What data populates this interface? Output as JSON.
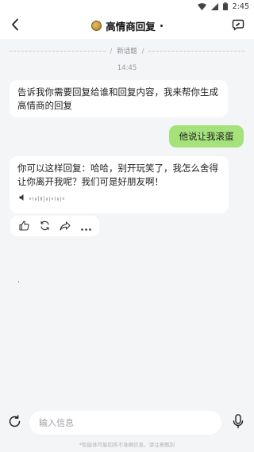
{
  "status_bar": {
    "time": "2:45"
  },
  "header": {
    "title": "高情商回复"
  },
  "chat": {
    "divider_label": "新话题",
    "timestamp": "14:45",
    "messages": [
      {
        "role": "assistant",
        "text": "告诉我你需要回复给谁和回复内容，我来帮你生成高情商的回复"
      },
      {
        "role": "user",
        "text": "他说让我滚蛋"
      },
      {
        "role": "assistant",
        "text": "你可以这样回复：哈哈，别开玩笑了，我怎么舍得让你离开我呢？我们可是好朋友啊！"
      }
    ]
  },
  "input": {
    "placeholder": "输入信息"
  },
  "footer": {
    "disclaimer": "*智能体可能回答不准确信息，请注意甄别"
  },
  "icons": {
    "back": "chevron-left-icon",
    "chat": "chat-bubble-icon",
    "refresh": "refresh-icon",
    "mic": "microphone-icon",
    "like": "thumbs-up-icon",
    "regenerate": "regenerate-icon",
    "share": "share-icon",
    "more": "more-icon"
  },
  "colors": {
    "user_bubble": "#a6e27b",
    "background": "#f4f5f7"
  }
}
